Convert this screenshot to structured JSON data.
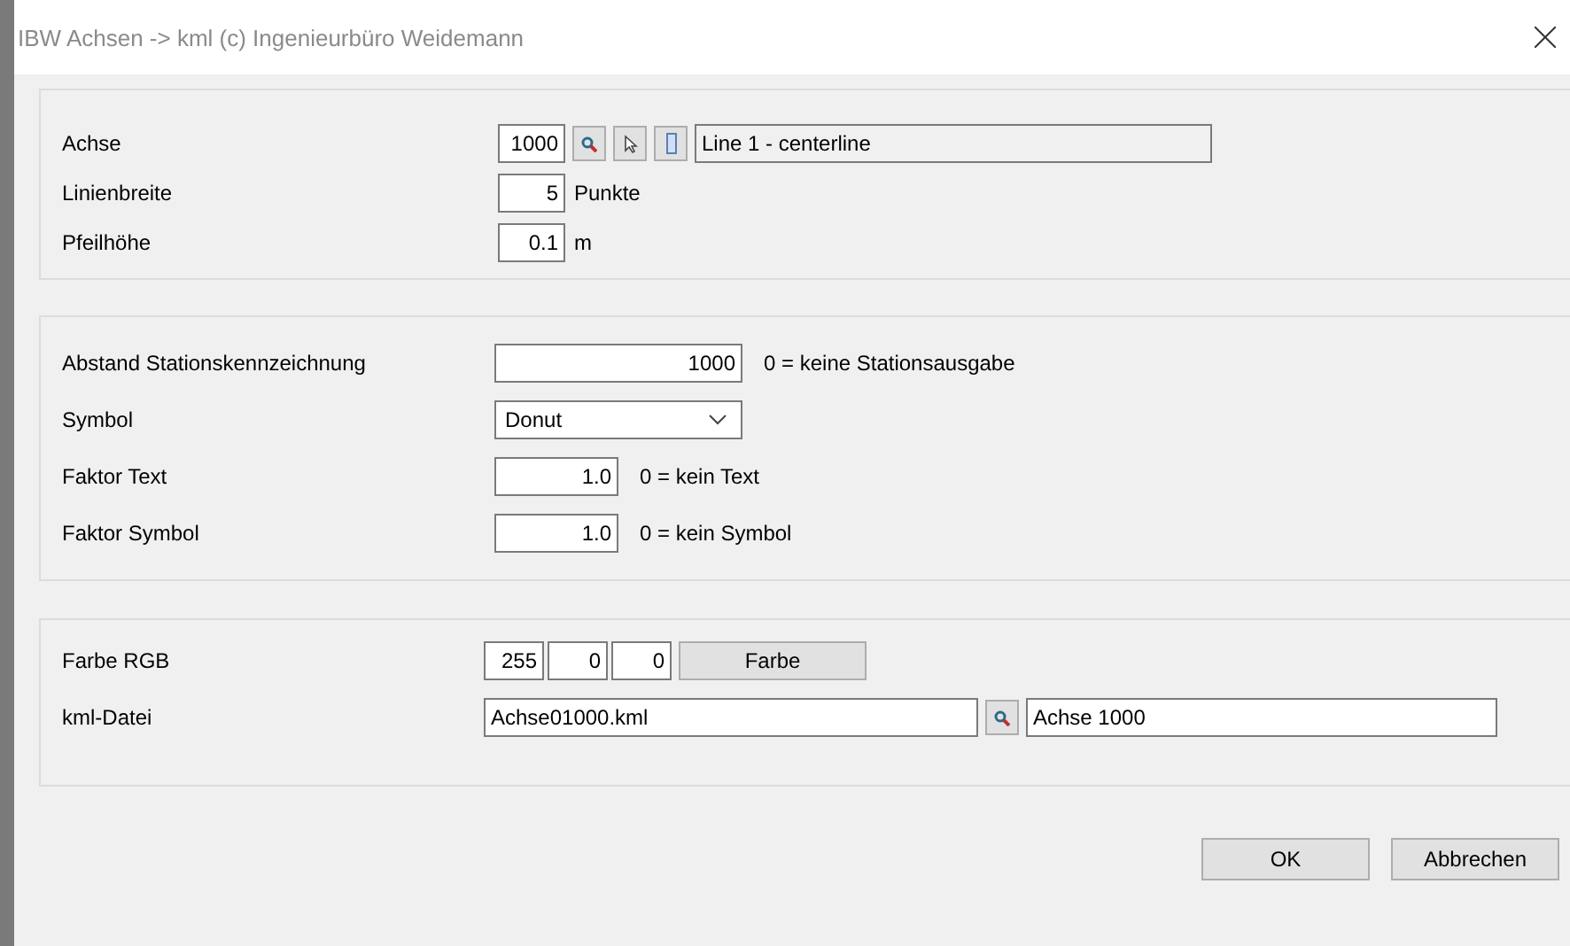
{
  "window": {
    "title": "IBW Achsen -> kml (c) Ingenieurbüro Weidemann"
  },
  "axis_section": {
    "axis": {
      "label": "Achse",
      "value": "1000",
      "name": "Line 1 - centerline"
    },
    "line_width": {
      "label": "Linienbreite",
      "value": "5",
      "unit": "Punkte"
    },
    "arrow_height": {
      "label": "Pfeilhöhe",
      "value": "0.1",
      "unit": "m"
    }
  },
  "station_section": {
    "rows": [
      {
        "kind": "field",
        "label": "Abstand Stationskennzeichnung",
        "value": "1000",
        "hint": "0 = keine Stationsausgabe",
        "wide": true
      },
      {
        "kind": "dropdown",
        "label": "Symbol",
        "value": "Donut"
      },
      {
        "kind": "field",
        "label": "Faktor Text",
        "value": "1.0",
        "hint": "0 = kein Text",
        "wide": false
      },
      {
        "kind": "field",
        "label": "Faktor Symbol",
        "value": "1.0",
        "hint": "0 = kein Symbol",
        "wide": false
      }
    ]
  },
  "output_section": {
    "color": {
      "label": "Farbe RGB",
      "r": "255",
      "g": "0",
      "b": "0",
      "button": "Farbe"
    },
    "kml_file": {
      "label": "kml-Datei",
      "file": "Achse01000.kml",
      "name": "Achse 1000"
    }
  },
  "buttons": [
    "OK",
    "Abbrechen"
  ]
}
